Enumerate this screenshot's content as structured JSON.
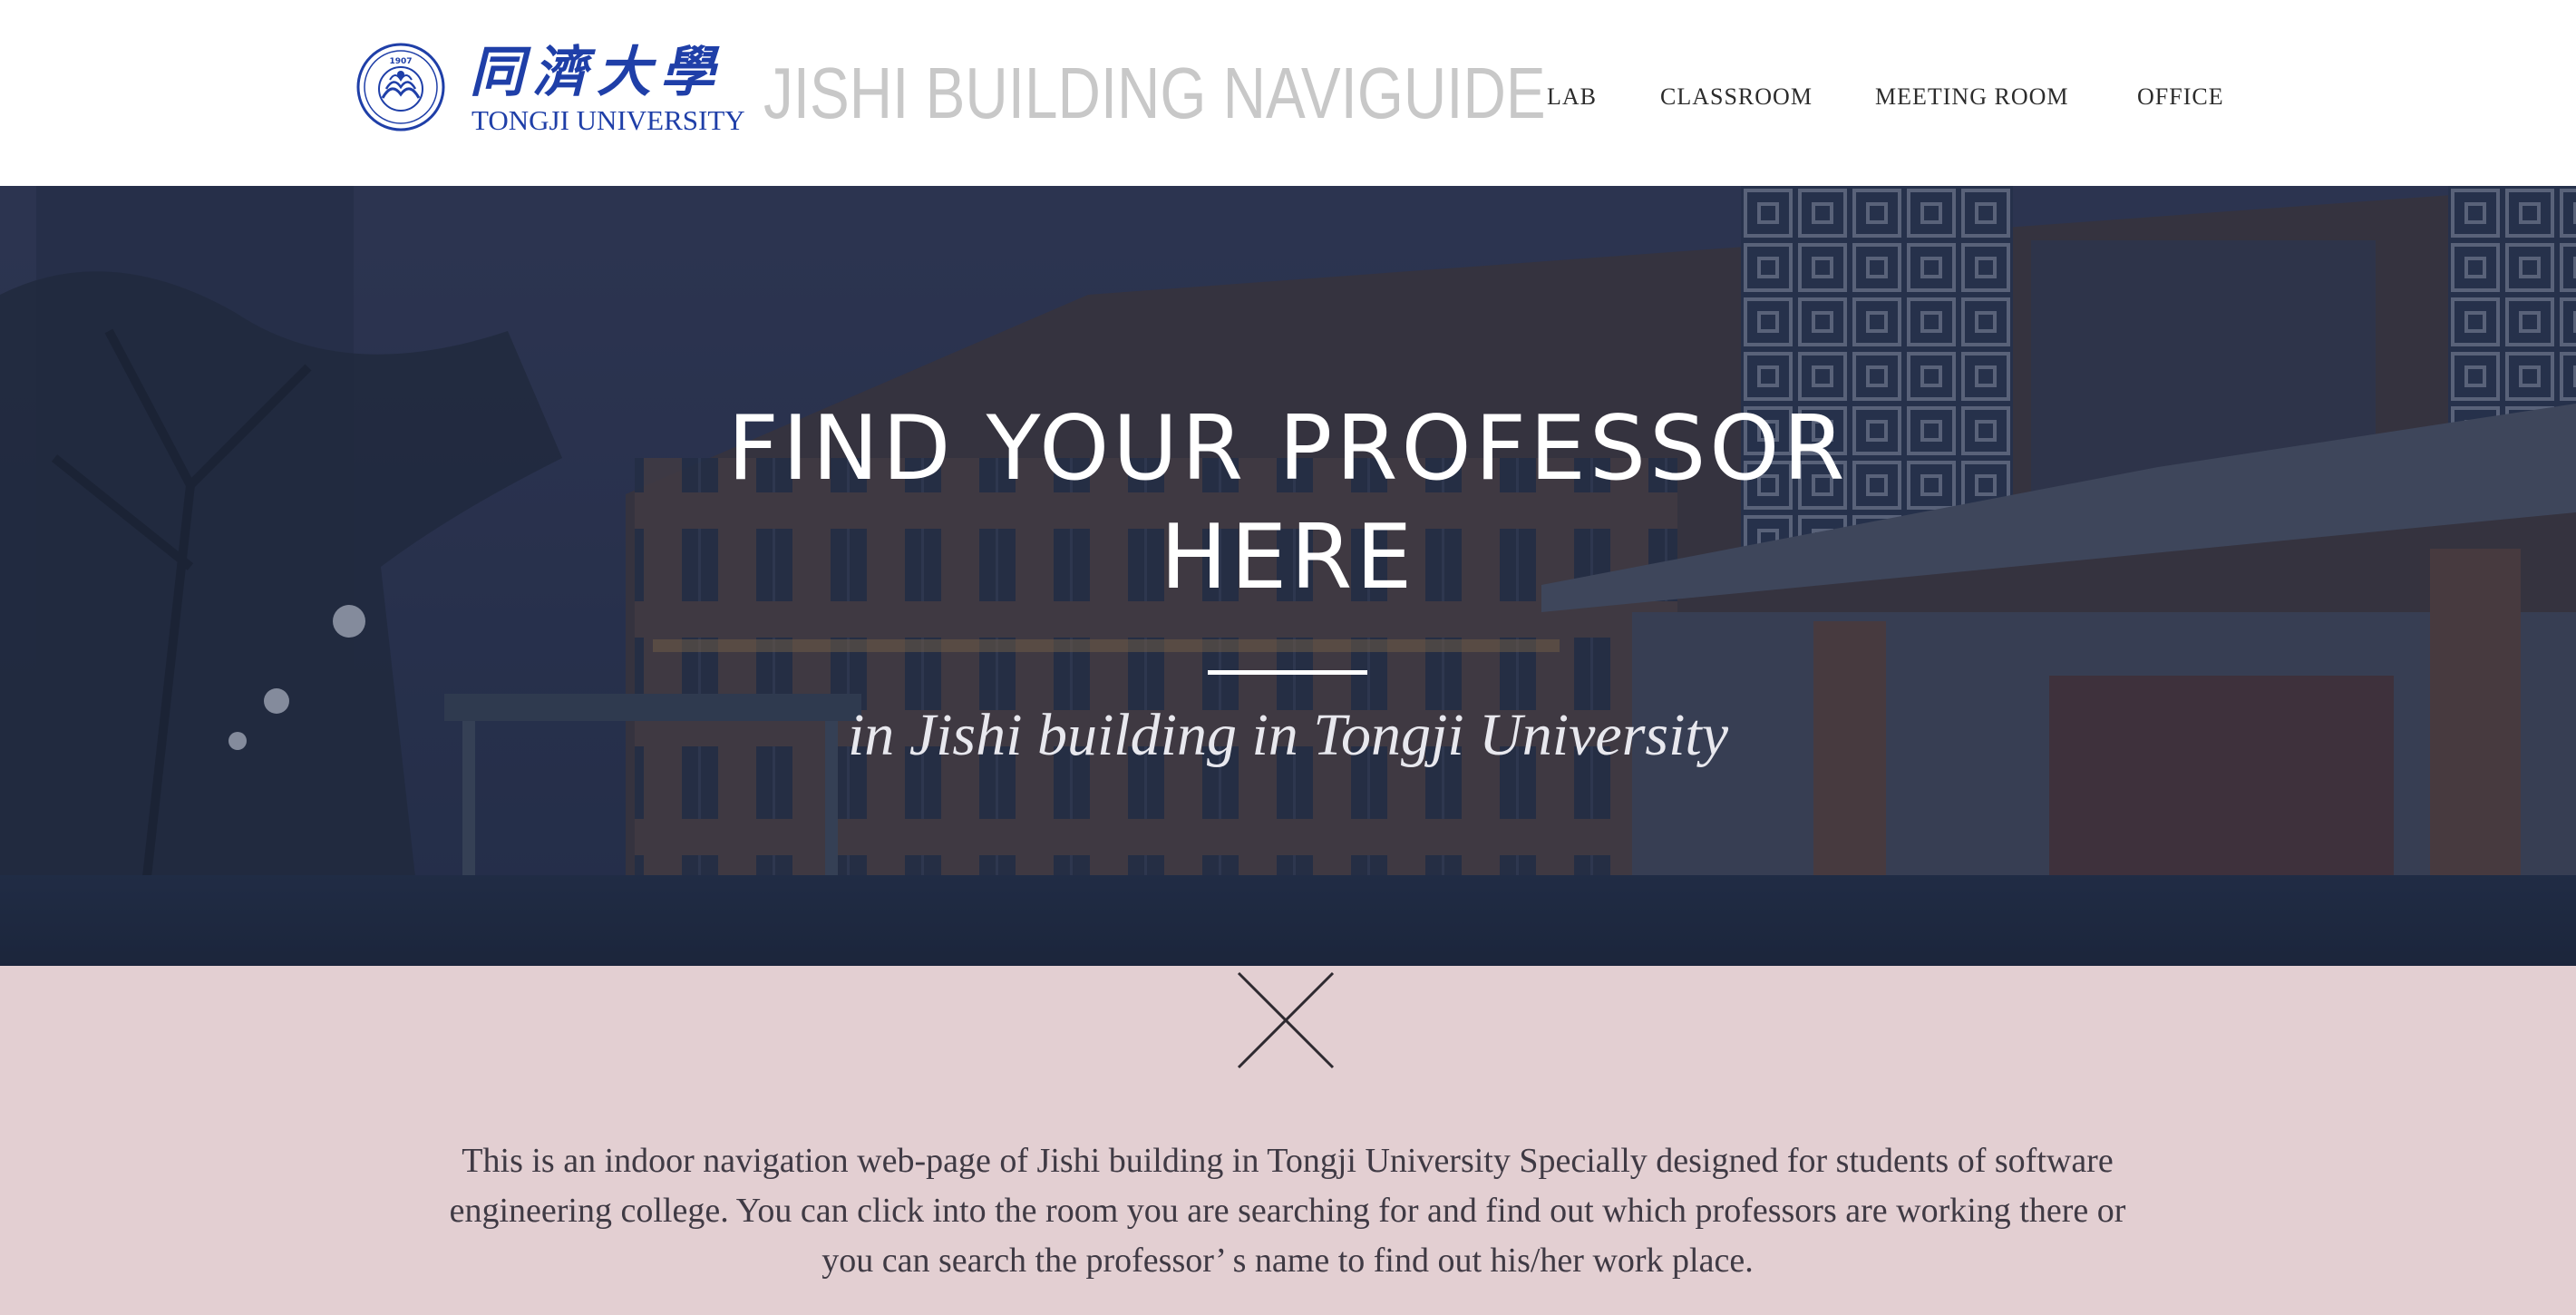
{
  "header": {
    "logo_cn": "同濟大學",
    "logo_en": "TONGJI UNIVERSITY",
    "seal_text": "1907",
    "site_title": "JISHI BUILDING NAVIGUIDE",
    "nav": {
      "lab": "LAB",
      "classroom": "CLASSROOM",
      "meeting_room": "MEETING ROOM",
      "office": "OFFICE"
    }
  },
  "hero": {
    "title_line1": "FIND YOUR PROFESSOR",
    "title_line2": "HERE",
    "subtitle": "in Jishi building in Tongji University"
  },
  "about": {
    "line1": "This is an indoor navigation web-page of Jishi building in Tongji University Specially designed for students of software",
    "line2": "engineering college. You can click into the room you are searching for and find out which professors are working there or",
    "line3": "you can search the professor’ s name to find out his/her work place."
  },
  "colors": {
    "logo_blue": "#1f3fa8",
    "title_gray": "#c8c8c8",
    "about_bg": "#e3cfd2",
    "hero_overlay": "#1c2840"
  },
  "icons": {
    "seal": "university-seal-icon",
    "divider": "cross-icon"
  }
}
